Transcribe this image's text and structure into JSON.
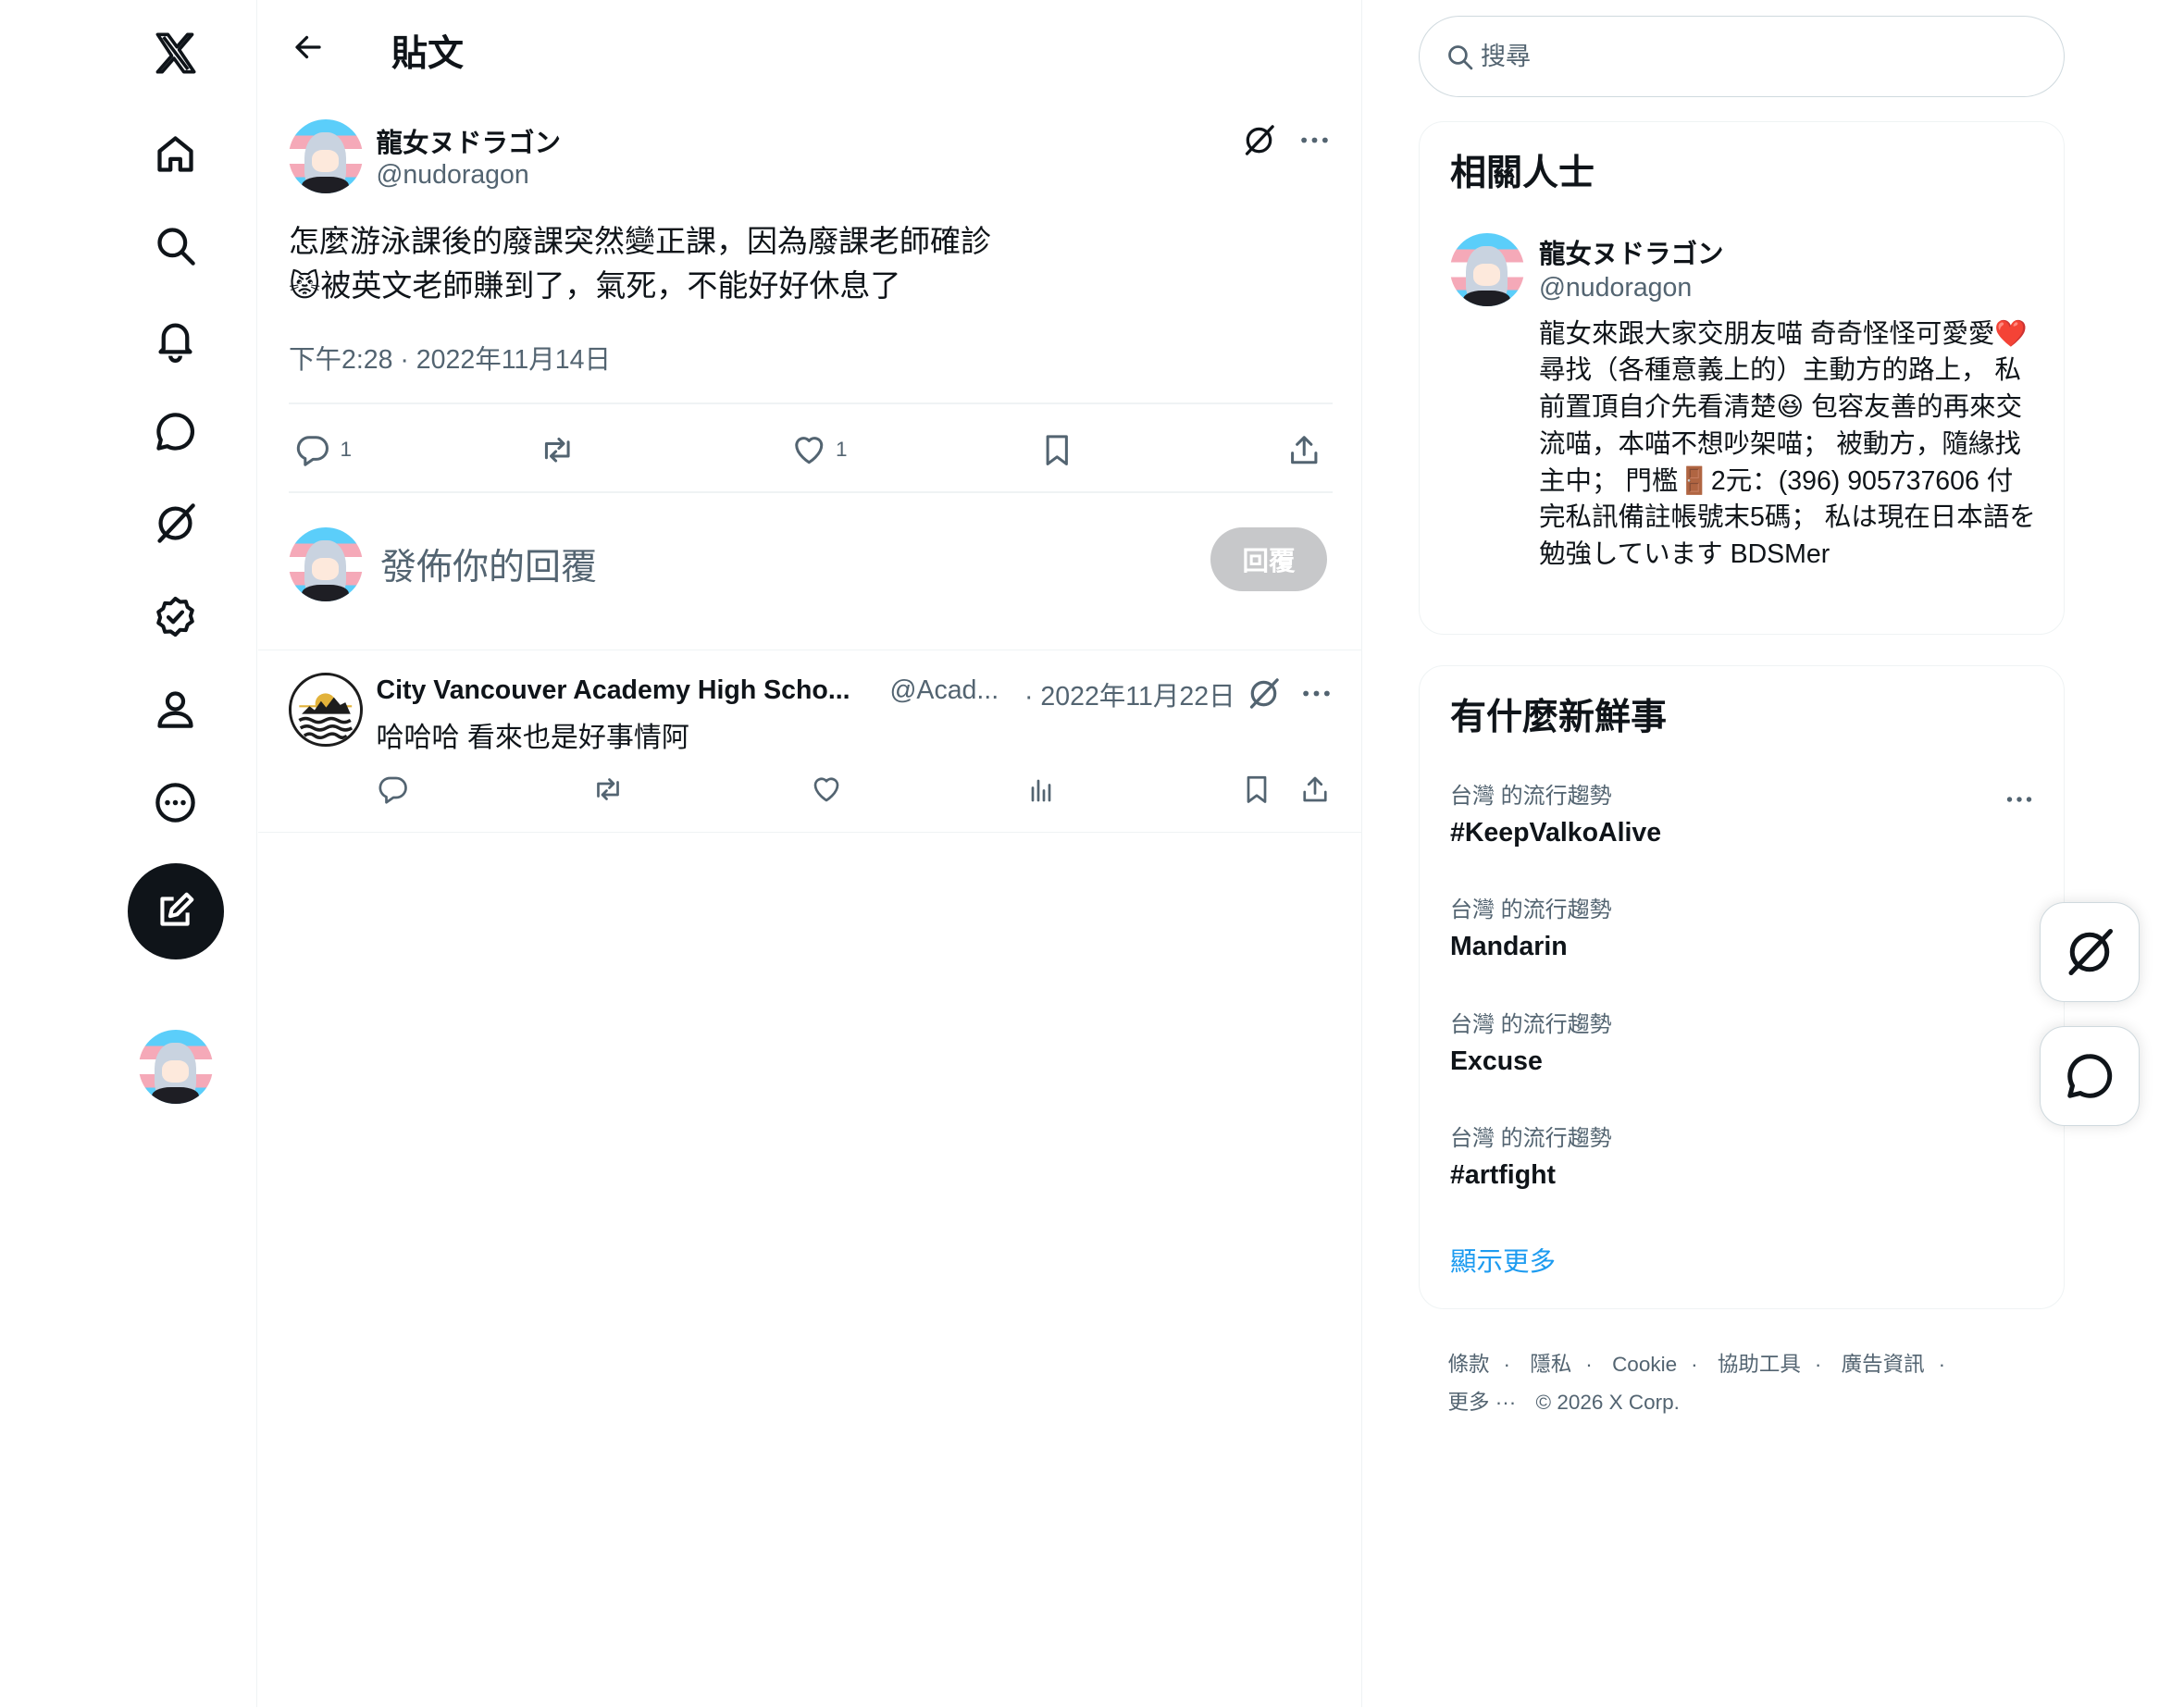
{
  "page": {
    "title": "貼文"
  },
  "nav": {
    "items": [
      "home",
      "explore",
      "notifications",
      "messages",
      "grok",
      "verified",
      "profile",
      "more"
    ]
  },
  "post": {
    "author_name": "龍女ヌドラゴン",
    "author_handle": "@nudoragon",
    "text_line1": "怎麼游泳課後的廢課突然變正課，因為廢課老師確診",
    "text_line2": "😾被英文老師賺到了，氣死，不能好好休息了",
    "timestamp": "下午2:28 · 2022年11月14日",
    "reply_count": "1",
    "like_count": "1"
  },
  "reply_composer": {
    "placeholder": "發佈你的回覆",
    "button_label": "回覆"
  },
  "reply": {
    "author_name": "City Vancouver Academy High Scho...",
    "author_handle": "@Acad...",
    "date": "· 2022年11月22日",
    "text": "哈哈哈  看來也是好事情阿"
  },
  "search": {
    "placeholder": "搜尋"
  },
  "relevant_people": {
    "title": "相關人士",
    "name": "龍女ヌドラゴン",
    "handle": "@nudoragon",
    "bio": "龍女來跟大家交朋友喵 奇奇怪怪可愛愛❤️ 尋找（各種意義上的）主動方的路上， 私前置頂自介先看清楚😆 包容友善的再來交流喵，本喵不想吵架喵； 被動方，隨緣找主中； 門檻🚪2元：(396) 905737606 付完私訊備註帳號末5碼； 私は現在日本語を勉強しています BDSMer"
  },
  "trends": {
    "title": "有什麼新鮮事",
    "items": [
      {
        "meta": "台灣 的流行趨勢",
        "name": "#KeepValkoAlive"
      },
      {
        "meta": "台灣 的流行趨勢",
        "name": "Mandarin"
      },
      {
        "meta": "台灣 的流行趨勢",
        "name": "Excuse"
      },
      {
        "meta": "台灣 的流行趨勢",
        "name": "#artfight"
      }
    ],
    "show_more": "顯示更多"
  },
  "footer": {
    "links": [
      "條款",
      "隱私",
      "Cookie",
      "協助工具",
      "廣告資訊"
    ],
    "more": "更多 ···",
    "copyright": "© 2026 X Corp."
  },
  "colors": {
    "accent": "#1d9bf0",
    "text": "#0f1419",
    "secondary": "#536471",
    "border": "#eff3f4"
  }
}
